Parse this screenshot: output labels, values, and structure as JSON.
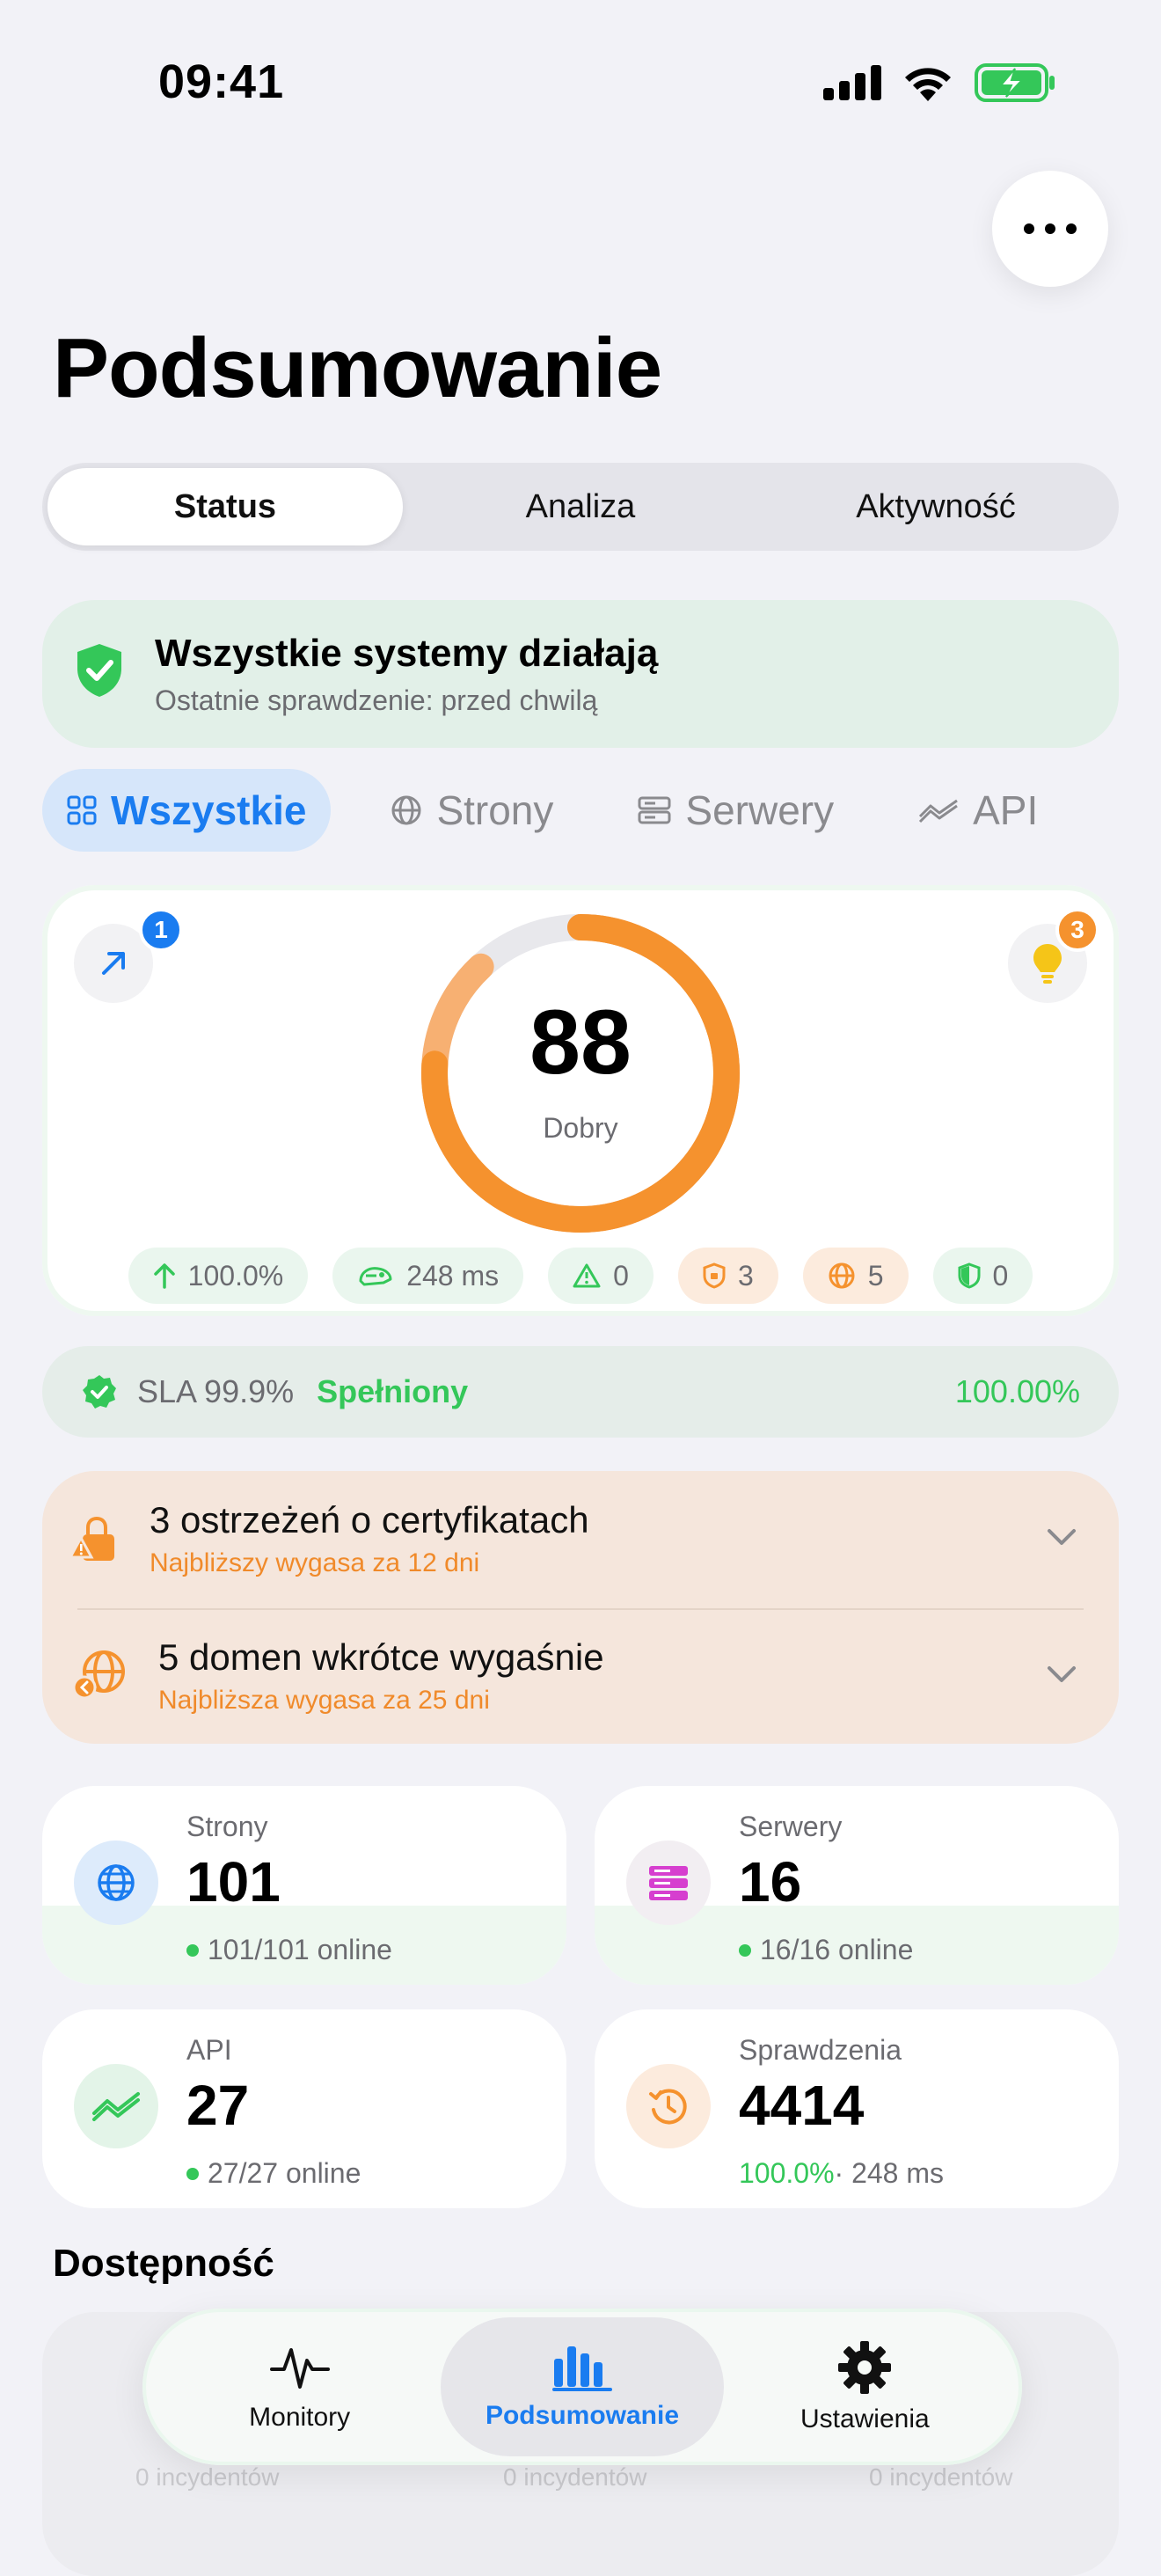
{
  "status_bar": {
    "time": "09:41"
  },
  "header": {
    "title": "Podsumowanie"
  },
  "segmented": {
    "tabs": [
      "Status",
      "Analiza",
      "Aktywność"
    ],
    "selected": "Status"
  },
  "banner": {
    "title": "Wszystkie systemy działają",
    "subtitle": "Ostatnie sprawdzenie: przed chwilą"
  },
  "filters": {
    "items": [
      "Wszystkie",
      "Strony",
      "Serwery",
      "API"
    ],
    "selected": "Wszystkie"
  },
  "score": {
    "value": "88",
    "label": "Dobry",
    "fraction": 0.88,
    "left_badge": "1",
    "right_badge": "3",
    "pills": {
      "uptime": "100.0%",
      "response": "248 ms",
      "alerts": "0",
      "certs": "3",
      "domains": "5",
      "security": "0"
    }
  },
  "sla": {
    "label": "SLA 99.9%",
    "status": "Spełniony",
    "value": "100.00%"
  },
  "warnings": {
    "certs_title": "3 ostrzeżeń o certyfikatach",
    "certs_sub": "Najbliższy wygasa za 12 dni",
    "domains_title": "5 domen wkrótce wygaśnie",
    "domains_sub": "Najbliższa wygasa za 25 dni"
  },
  "stats": {
    "pages": {
      "label": "Strony",
      "value": "101",
      "sub": "101/101 online"
    },
    "servers": {
      "label": "Serwery",
      "value": "16",
      "sub": "16/16 online"
    },
    "api": {
      "label": "API",
      "value": "27",
      "sub": "27/27 online"
    },
    "checks": {
      "label": "Sprawdzenia",
      "value": "4414",
      "sub_pct": "100.0%",
      "sub_rest": " · 248 ms"
    }
  },
  "availability": {
    "title": "Dostępność",
    "ghost_label": "0 incydentów"
  },
  "tabbar": {
    "items": [
      "Monitory",
      "Podsumowanie",
      "Ustawienia"
    ],
    "selected": "Podsumowanie"
  },
  "colors": {
    "accent": "#1A7CF0",
    "success": "#34C759",
    "warning": "#F5922E"
  }
}
